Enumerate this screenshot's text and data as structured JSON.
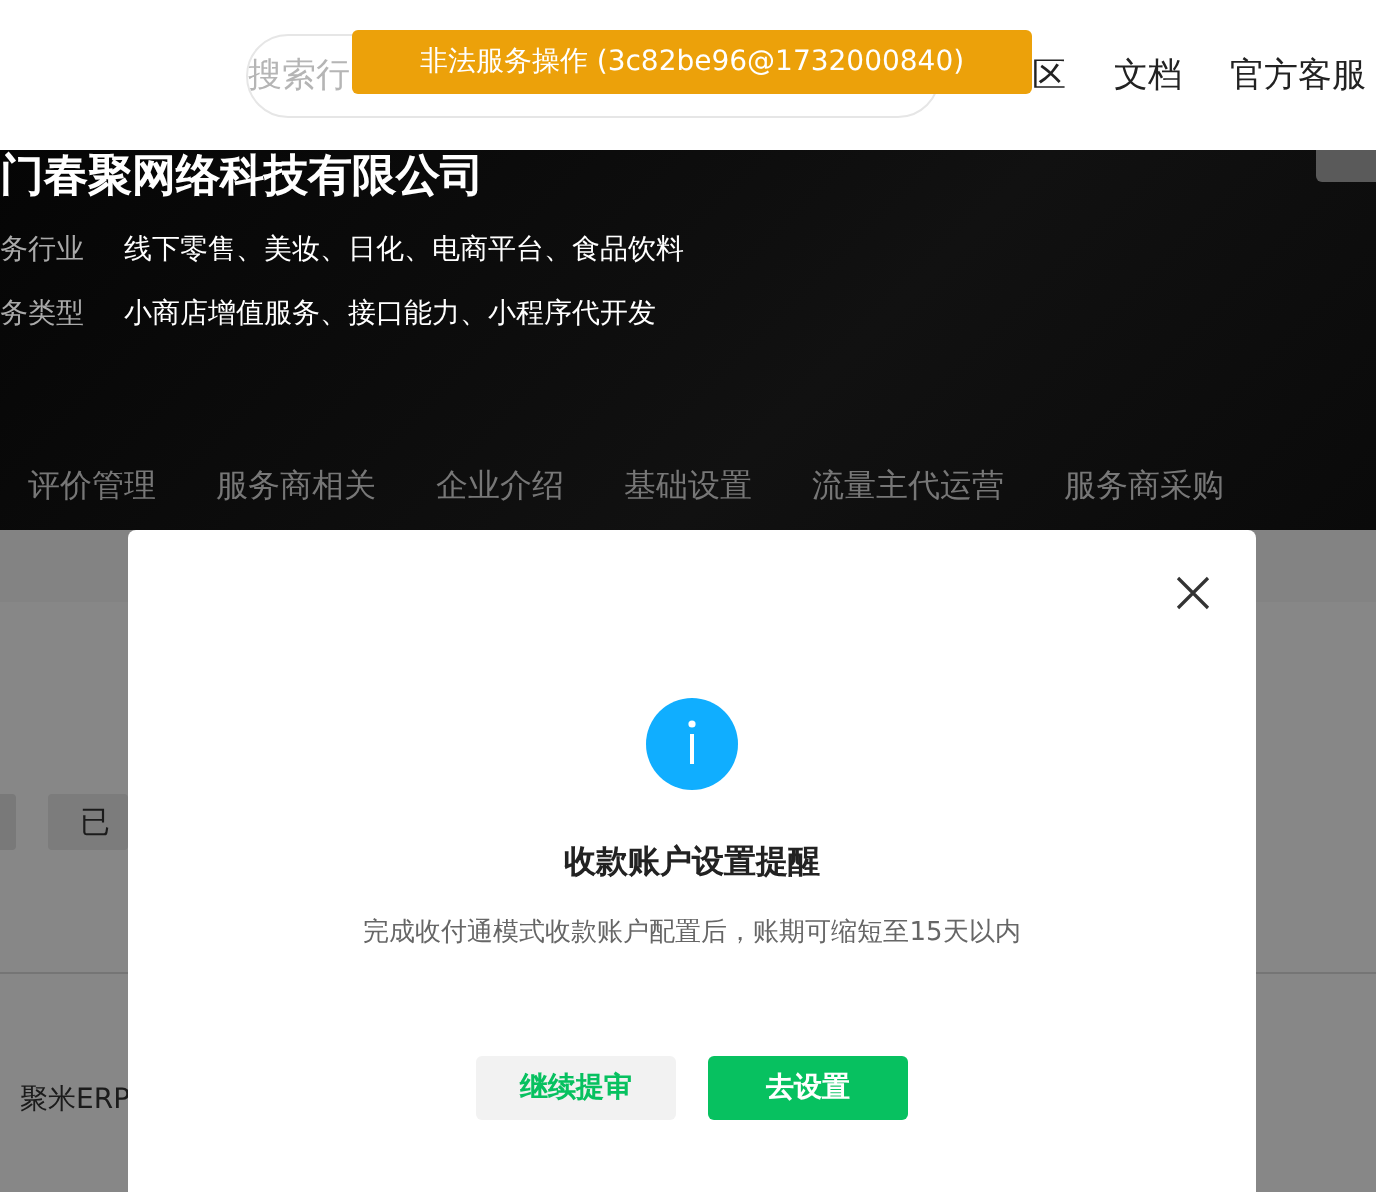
{
  "header": {
    "search": {
      "placeholder": "搜索行"
    },
    "nav": [
      "区",
      "文档",
      "官方客服"
    ]
  },
  "toast": {
    "text": "非法服务操作 (3c82be96@1732000840)"
  },
  "profile": {
    "company": "门春聚网络科技有限公司",
    "fields": [
      {
        "label": "务行业",
        "value": "线下零售、美妆、日化、电商平台、食品饮料"
      },
      {
        "label": "务类型",
        "value": "小商店增值服务、接口能力、小程序代开发"
      }
    ],
    "tabs": [
      {
        "label": "评价管理",
        "selected": false
      },
      {
        "label": "服务商相关",
        "selected": false
      },
      {
        "label": "企业介绍",
        "selected": false
      },
      {
        "label": "基础设置",
        "selected": false
      },
      {
        "label": "流量主代运营",
        "selected": false
      },
      {
        "label": "服务商采购",
        "selected": false
      }
    ]
  },
  "content": {
    "chips": [
      "已"
    ],
    "row": {
      "name": "聚米ERP"
    }
  },
  "dialog": {
    "title": "收款账户设置提醒",
    "message": "完成收付通模式收款账户配置后，账期可缩短至15天以内",
    "buttons": [
      {
        "label": "继续提审",
        "kind": "secondary"
      },
      {
        "label": "去设置",
        "kind": "primary"
      }
    ]
  }
}
